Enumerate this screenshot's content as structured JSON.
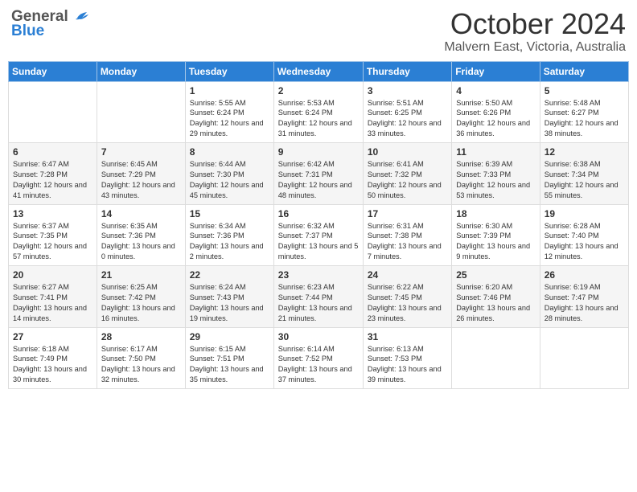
{
  "header": {
    "logo_general": "General",
    "logo_blue": "Blue",
    "month_title": "October 2024",
    "subtitle": "Malvern East, Victoria, Australia"
  },
  "weekdays": [
    "Sunday",
    "Monday",
    "Tuesday",
    "Wednesday",
    "Thursday",
    "Friday",
    "Saturday"
  ],
  "weeks": [
    [
      {
        "day": "",
        "info": ""
      },
      {
        "day": "",
        "info": ""
      },
      {
        "day": "1",
        "info": "Sunrise: 5:55 AM\nSunset: 6:24 PM\nDaylight: 12 hours and 29 minutes."
      },
      {
        "day": "2",
        "info": "Sunrise: 5:53 AM\nSunset: 6:24 PM\nDaylight: 12 hours and 31 minutes."
      },
      {
        "day": "3",
        "info": "Sunrise: 5:51 AM\nSunset: 6:25 PM\nDaylight: 12 hours and 33 minutes."
      },
      {
        "day": "4",
        "info": "Sunrise: 5:50 AM\nSunset: 6:26 PM\nDaylight: 12 hours and 36 minutes."
      },
      {
        "day": "5",
        "info": "Sunrise: 5:48 AM\nSunset: 6:27 PM\nDaylight: 12 hours and 38 minutes."
      }
    ],
    [
      {
        "day": "6",
        "info": "Sunrise: 6:47 AM\nSunset: 7:28 PM\nDaylight: 12 hours and 41 minutes."
      },
      {
        "day": "7",
        "info": "Sunrise: 6:45 AM\nSunset: 7:29 PM\nDaylight: 12 hours and 43 minutes."
      },
      {
        "day": "8",
        "info": "Sunrise: 6:44 AM\nSunset: 7:30 PM\nDaylight: 12 hours and 45 minutes."
      },
      {
        "day": "9",
        "info": "Sunrise: 6:42 AM\nSunset: 7:31 PM\nDaylight: 12 hours and 48 minutes."
      },
      {
        "day": "10",
        "info": "Sunrise: 6:41 AM\nSunset: 7:32 PM\nDaylight: 12 hours and 50 minutes."
      },
      {
        "day": "11",
        "info": "Sunrise: 6:39 AM\nSunset: 7:33 PM\nDaylight: 12 hours and 53 minutes."
      },
      {
        "day": "12",
        "info": "Sunrise: 6:38 AM\nSunset: 7:34 PM\nDaylight: 12 hours and 55 minutes."
      }
    ],
    [
      {
        "day": "13",
        "info": "Sunrise: 6:37 AM\nSunset: 7:35 PM\nDaylight: 12 hours and 57 minutes."
      },
      {
        "day": "14",
        "info": "Sunrise: 6:35 AM\nSunset: 7:36 PM\nDaylight: 13 hours and 0 minutes."
      },
      {
        "day": "15",
        "info": "Sunrise: 6:34 AM\nSunset: 7:36 PM\nDaylight: 13 hours and 2 minutes."
      },
      {
        "day": "16",
        "info": "Sunrise: 6:32 AM\nSunset: 7:37 PM\nDaylight: 13 hours and 5 minutes."
      },
      {
        "day": "17",
        "info": "Sunrise: 6:31 AM\nSunset: 7:38 PM\nDaylight: 13 hours and 7 minutes."
      },
      {
        "day": "18",
        "info": "Sunrise: 6:30 AM\nSunset: 7:39 PM\nDaylight: 13 hours and 9 minutes."
      },
      {
        "day": "19",
        "info": "Sunrise: 6:28 AM\nSunset: 7:40 PM\nDaylight: 13 hours and 12 minutes."
      }
    ],
    [
      {
        "day": "20",
        "info": "Sunrise: 6:27 AM\nSunset: 7:41 PM\nDaylight: 13 hours and 14 minutes."
      },
      {
        "day": "21",
        "info": "Sunrise: 6:25 AM\nSunset: 7:42 PM\nDaylight: 13 hours and 16 minutes."
      },
      {
        "day": "22",
        "info": "Sunrise: 6:24 AM\nSunset: 7:43 PM\nDaylight: 13 hours and 19 minutes."
      },
      {
        "day": "23",
        "info": "Sunrise: 6:23 AM\nSunset: 7:44 PM\nDaylight: 13 hours and 21 minutes."
      },
      {
        "day": "24",
        "info": "Sunrise: 6:22 AM\nSunset: 7:45 PM\nDaylight: 13 hours and 23 minutes."
      },
      {
        "day": "25",
        "info": "Sunrise: 6:20 AM\nSunset: 7:46 PM\nDaylight: 13 hours and 26 minutes."
      },
      {
        "day": "26",
        "info": "Sunrise: 6:19 AM\nSunset: 7:47 PM\nDaylight: 13 hours and 28 minutes."
      }
    ],
    [
      {
        "day": "27",
        "info": "Sunrise: 6:18 AM\nSunset: 7:49 PM\nDaylight: 13 hours and 30 minutes."
      },
      {
        "day": "28",
        "info": "Sunrise: 6:17 AM\nSunset: 7:50 PM\nDaylight: 13 hours and 32 minutes."
      },
      {
        "day": "29",
        "info": "Sunrise: 6:15 AM\nSunset: 7:51 PM\nDaylight: 13 hours and 35 minutes."
      },
      {
        "day": "30",
        "info": "Sunrise: 6:14 AM\nSunset: 7:52 PM\nDaylight: 13 hours and 37 minutes."
      },
      {
        "day": "31",
        "info": "Sunrise: 6:13 AM\nSunset: 7:53 PM\nDaylight: 13 hours and 39 minutes."
      },
      {
        "day": "",
        "info": ""
      },
      {
        "day": "",
        "info": ""
      }
    ]
  ]
}
